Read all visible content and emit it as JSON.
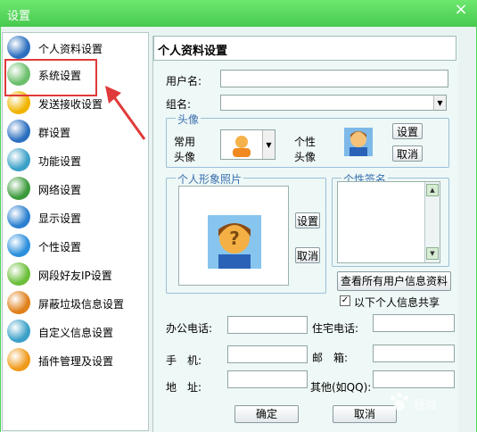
{
  "window": {
    "title": "设置",
    "close_glyph": "×"
  },
  "sidebar": {
    "items": [
      {
        "label": "个人资料设置",
        "icon": "person-icon",
        "color": "#2b6fbf"
      },
      {
        "label": "系统设置",
        "icon": "system-icon",
        "color": "#6bbf6b"
      },
      {
        "label": "发送接收设置",
        "icon": "send-receive-icon",
        "color": "#f0b400"
      },
      {
        "label": "群设置",
        "icon": "group-icon",
        "color": "#2b6fbf"
      },
      {
        "label": "功能设置",
        "icon": "function-icon",
        "color": "#3aa0c8"
      },
      {
        "label": "网络设置",
        "icon": "network-icon",
        "color": "#3b9a3b"
      },
      {
        "label": "显示设置",
        "icon": "display-icon",
        "color": "#2b7fd0"
      },
      {
        "label": "个性设置",
        "icon": "personality-icon",
        "color": "#2b8fdc"
      },
      {
        "label": "网段好友IP设置",
        "icon": "ip-friend-icon",
        "color": "#6cbf3a"
      },
      {
        "label": "屏蔽垃圾信息设置",
        "icon": "block-spam-icon",
        "color": "#e0801a"
      },
      {
        "label": "自定义信息设置",
        "icon": "custom-info-icon",
        "color": "#3aa0c8"
      },
      {
        "label": "插件管理及设置",
        "icon": "plugin-icon",
        "color": "#f09a1a"
      }
    ]
  },
  "main": {
    "section_title": "个人资料设置",
    "username_label": "用户名:",
    "username_value": "",
    "group_label": "组名:",
    "group_value": "",
    "avatar": {
      "group_title": "头像",
      "common_label_1": "常用",
      "common_label_2": "头像",
      "custom_label_1": "个性",
      "custom_label_2": "头像",
      "set_button": "设置",
      "cancel_button": "取消"
    },
    "photo": {
      "group_title": "个人形象照片",
      "set_button": "设置",
      "cancel_button": "取消"
    },
    "signature": {
      "group_title": "个性签名"
    },
    "view_all_button": "查看所有用户信息资料",
    "share_label": "以下个人信息共享",
    "share_checked": "✓",
    "fields": {
      "office_phone": "办公电话:",
      "home_phone": "住宅电话:",
      "mobile": "手　机:",
      "email": "邮　箱:",
      "address": "地　址:",
      "other": "其他(如QQ):"
    },
    "ok_button": "确定",
    "cancel_button": "取消"
  },
  "watermark": "经验"
}
